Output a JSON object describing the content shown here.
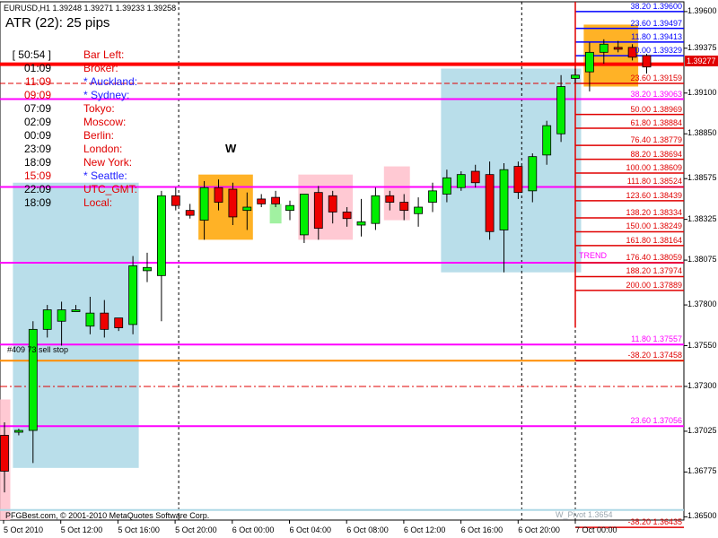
{
  "header": {
    "symbol_line": "EURUSD,H1  1.39248 1.39271 1.39233 1.39258",
    "atr_label": "ATR (22): 25 pips"
  },
  "clock_panel": {
    "rows": [
      {
        "time": "[ 50:54 ]",
        "name": "Bar Left:",
        "time_color": "#000000",
        "name_color": "#e00000"
      },
      {
        "time": "01:09",
        "name": "Broker:",
        "time_color": "#000000",
        "name_color": "#e00000"
      },
      {
        "time": "11:09",
        "name": "* Auckland:",
        "time_color": "#e00000",
        "name_color": "#2020ff"
      },
      {
        "time": "09:09",
        "name": "* Sydney:",
        "time_color": "#e00000",
        "name_color": "#2020ff"
      },
      {
        "time": "07:09",
        "name": "Tokyo:",
        "time_color": "#000000",
        "name_color": "#e00000"
      },
      {
        "time": "02:09",
        "name": "Moscow:",
        "time_color": "#000000",
        "name_color": "#e00000"
      },
      {
        "time": "00:09",
        "name": "Berlin:",
        "time_color": "#000000",
        "name_color": "#e00000"
      },
      {
        "time": "23:09",
        "name": "London:",
        "time_color": "#000000",
        "name_color": "#e00000"
      },
      {
        "time": "18:09",
        "name": "New York:",
        "time_color": "#000000",
        "name_color": "#e00000"
      },
      {
        "time": "15:09",
        "name": "* Seattle:",
        "time_color": "#e00000",
        "name_color": "#2020ff"
      },
      {
        "time": "22:09",
        "name": "UTC_GMT:",
        "time_color": "#000000",
        "name_color": "#e00000"
      },
      {
        "time": "18:09",
        "name": "Local:",
        "time_color": "#000000",
        "name_color": "#e00000"
      }
    ]
  },
  "annotations": {
    "marker": "W",
    "order_label": "#409 73 sell stop",
    "trend_label": "TREND",
    "pivot_label": "W_Pivot 1.3654",
    "copyright": "PFGBest.com, © 2001-2010 MetaQuotes Software Corp."
  },
  "current_price": "1.39277",
  "fib_levels": [
    {
      "ratio": "38.20",
      "price": "1.39600",
      "color": "#0000ff"
    },
    {
      "ratio": "23.60",
      "price": "1.39497",
      "color": "#0000ff"
    },
    {
      "ratio": "11.80",
      "price": "1.39413",
      "color": "#0000ff"
    },
    {
      "ratio": "0.00",
      "price": "1.39329",
      "color": "#0000ff"
    },
    {
      "ratio": "23.60",
      "price": "1.39159",
      "color": "#e00000"
    },
    {
      "ratio": "38.20",
      "price": "1.39063",
      "color": "#ff00ff"
    },
    {
      "ratio": "50.00",
      "price": "1.38969",
      "color": "#e00000"
    },
    {
      "ratio": "61.80",
      "price": "1.38884",
      "color": "#e00000"
    },
    {
      "ratio": "76.40",
      "price": "1.38779",
      "color": "#e00000"
    },
    {
      "ratio": "88.20",
      "price": "1.38694",
      "color": "#e00000"
    },
    {
      "ratio": "100.00",
      "price": "1.38609",
      "color": "#e00000"
    },
    {
      "ratio": "111.80",
      "price": "1.38524",
      "color": "#e00000"
    },
    {
      "ratio": "123.60",
      "price": "1.38439",
      "color": "#e00000"
    },
    {
      "ratio": "138.20",
      "price": "1.38334",
      "color": "#e00000"
    },
    {
      "ratio": "150.00",
      "price": "1.38249",
      "color": "#e00000"
    },
    {
      "ratio": "161.80",
      "price": "1.38164",
      "color": "#e00000"
    },
    {
      "ratio": "176.40",
      "price": "1.38059",
      "color": "#e00000"
    },
    {
      "ratio": "188.20",
      "price": "1.37974",
      "color": "#e00000"
    },
    {
      "ratio": "200.00",
      "price": "1.37889",
      "color": "#e00000"
    },
    {
      "ratio": "11.80",
      "price": "1.37557",
      "color": "#ff00ff"
    },
    {
      "ratio": "-38.20",
      "price": "1.37458",
      "color": "#e00000"
    },
    {
      "ratio": "23.60",
      "price": "1.37056",
      "color": "#ff00ff"
    },
    {
      "ratio": "-38.20",
      "price": "1.36435",
      "color": "#e00000"
    }
  ],
  "chart_data": {
    "type": "candlestick",
    "symbol": "EURUSD",
    "timeframe": "H1",
    "y_range": [
      1.3648,
      1.3966
    ],
    "price_ticks": [
      "1.39600",
      "1.39375",
      "1.39100",
      "1.38850",
      "1.38575",
      "1.38325",
      "1.38075",
      "1.37800",
      "1.37550",
      "1.37300",
      "1.37025",
      "1.36775",
      "1.36500"
    ],
    "time_ticks": [
      "5 Oct 2010",
      "5 Oct 12:00",
      "5 Oct 16:00",
      "5 Oct 20:00",
      "6 Oct 00:00",
      "6 Oct 04:00",
      "6 Oct 08:00",
      "6 Oct 12:00",
      "6 Oct 16:00",
      "6 Oct 20:00",
      "7 Oct 00:00"
    ],
    "candles": [
      {
        "o": 1.37,
        "h": 1.3708,
        "l": 1.3665,
        "c": 1.3678
      },
      {
        "o": 1.3702,
        "h": 1.3704,
        "l": 1.37,
        "c": 1.3703
      },
      {
        "o": 1.3703,
        "h": 1.377,
        "l": 1.3683,
        "c": 1.3765
      },
      {
        "o": 1.3765,
        "h": 1.378,
        "l": 1.376,
        "c": 1.3777
      },
      {
        "o": 1.377,
        "h": 1.3782,
        "l": 1.3755,
        "c": 1.3777
      },
      {
        "o": 1.3777,
        "h": 1.378,
        "l": 1.3776,
        "c": 1.3777
      },
      {
        "o": 1.3767,
        "h": 1.3785,
        "l": 1.3762,
        "c": 1.3775
      },
      {
        "o": 1.3775,
        "h": 1.3783,
        "l": 1.376,
        "c": 1.3765
      },
      {
        "o": 1.3772,
        "h": 1.3772,
        "l": 1.3764,
        "c": 1.3766
      },
      {
        "o": 1.3768,
        "h": 1.381,
        "l": 1.3762,
        "c": 1.3804
      },
      {
        "o": 1.3801,
        "h": 1.3812,
        "l": 1.3794,
        "c": 1.3803
      },
      {
        "o": 1.3798,
        "h": 1.385,
        "l": 1.377,
        "c": 1.3847
      },
      {
        "o": 1.3847,
        "h": 1.3852,
        "l": 1.3838,
        "c": 1.3841
      },
      {
        "o": 1.3838,
        "h": 1.3842,
        "l": 1.3833,
        "c": 1.3835
      },
      {
        "o": 1.3832,
        "h": 1.3856,
        "l": 1.382,
        "c": 1.3852
      },
      {
        "o": 1.3852,
        "h": 1.3857,
        "l": 1.3838,
        "c": 1.3843
      },
      {
        "o": 1.3851,
        "h": 1.3855,
        "l": 1.3829,
        "c": 1.3834
      },
      {
        "o": 1.3838,
        "h": 1.3849,
        "l": 1.3826,
        "c": 1.384
      },
      {
        "o": 1.3845,
        "h": 1.3848,
        "l": 1.384,
        "c": 1.3842
      },
      {
        "o": 1.3846,
        "h": 1.385,
        "l": 1.384,
        "c": 1.3842
      },
      {
        "o": 1.3838,
        "h": 1.3844,
        "l": 1.3832,
        "c": 1.3841
      },
      {
        "o": 1.3823,
        "h": 1.384,
        "l": 1.3818,
        "c": 1.3848
      },
      {
        "o": 1.3849,
        "h": 1.3853,
        "l": 1.382,
        "c": 1.3827
      },
      {
        "o": 1.3847,
        "h": 1.385,
        "l": 1.383,
        "c": 1.3837
      },
      {
        "o": 1.3837,
        "h": 1.384,
        "l": 1.3828,
        "c": 1.3833
      },
      {
        "o": 1.3829,
        "h": 1.3845,
        "l": 1.3822,
        "c": 1.3831
      },
      {
        "o": 1.383,
        "h": 1.3852,
        "l": 1.3826,
        "c": 1.3847
      },
      {
        "o": 1.3847,
        "h": 1.385,
        "l": 1.3838,
        "c": 1.3843
      },
      {
        "o": 1.3843,
        "h": 1.3848,
        "l": 1.3832,
        "c": 1.3838
      },
      {
        "o": 1.3836,
        "h": 1.3846,
        "l": 1.3828,
        "c": 1.384
      },
      {
        "o": 1.3843,
        "h": 1.3855,
        "l": 1.3837,
        "c": 1.385
      },
      {
        "o": 1.3848,
        "h": 1.3863,
        "l": 1.3843,
        "c": 1.3858
      },
      {
        "o": 1.3852,
        "h": 1.3862,
        "l": 1.385,
        "c": 1.386
      },
      {
        "o": 1.3862,
        "h": 1.3866,
        "l": 1.3852,
        "c": 1.3855
      },
      {
        "o": 1.386,
        "h": 1.3868,
        "l": 1.382,
        "c": 1.3825
      },
      {
        "o": 1.3826,
        "h": 1.3867,
        "l": 1.38,
        "c": 1.3863
      },
      {
        "o": 1.3865,
        "h": 1.3868,
        "l": 1.3845,
        "c": 1.3849
      },
      {
        "o": 1.385,
        "h": 1.3873,
        "l": 1.3843,
        "c": 1.3871
      },
      {
        "o": 1.3872,
        "h": 1.3893,
        "l": 1.3866,
        "c": 1.389
      },
      {
        "o": 1.3885,
        "h": 1.3921,
        "l": 1.388,
        "c": 1.3914
      },
      {
        "o": 1.3919,
        "h": 1.3925,
        "l": 1.3916,
        "c": 1.3921
      },
      {
        "o": 1.3923,
        "h": 1.3941,
        "l": 1.3911,
        "c": 1.3935
      },
      {
        "o": 1.3935,
        "h": 1.3943,
        "l": 1.3928,
        "c": 1.394
      },
      {
        "o": 1.3938,
        "h": 1.3942,
        "l": 1.3935,
        "c": 1.3937
      },
      {
        "o": 1.3938,
        "h": 1.394,
        "l": 1.393,
        "c": 1.3932
      },
      {
        "o": 1.3933,
        "h": 1.3934,
        "l": 1.3922,
        "c": 1.3926
      }
    ],
    "horizontal_lines": [
      {
        "price": 1.39277,
        "color": "#ff0000",
        "style": "solid-thick"
      },
      {
        "price": 1.39159,
        "color": "#e00000",
        "style": "dashed"
      },
      {
        "price": 1.39063,
        "color": "#ff00ff",
        "style": "solid"
      },
      {
        "price": 1.38524,
        "color": "#ff00ff",
        "style": "solid"
      },
      {
        "price": 1.38059,
        "color": "#ff00ff",
        "style": "solid"
      },
      {
        "price": 1.37557,
        "color": "#ff00ff",
        "style": "solid"
      },
      {
        "price": 1.37458,
        "color": "#ff8c00",
        "style": "solid"
      },
      {
        "price": 1.37056,
        "color": "#ff00ff",
        "style": "solid"
      },
      {
        "price": 1.373,
        "color": "#e00000",
        "style": "dashdot"
      },
      {
        "price": 1.36542,
        "color": "#add8e6",
        "style": "solid"
      }
    ],
    "session_boxes": [
      {
        "from": 1,
        "to": 9,
        "high": 1.3855,
        "low": 1.368,
        "color": "#add8e6"
      },
      {
        "from": 0,
        "to": 0,
        "high": 1.3722,
        "low": 1.3648,
        "color": "#ffc0cb"
      },
      {
        "from": 14,
        "to": 17,
        "high": 1.386,
        "low": 1.382,
        "color": "#ffa500"
      },
      {
        "from": 19,
        "to": 19,
        "high": 1.3842,
        "low": 1.383,
        "color": "#90ee90"
      },
      {
        "from": 21,
        "to": 24,
        "high": 1.386,
        "low": 1.382,
        "color": "#ffc0cb"
      },
      {
        "from": 27,
        "to": 28,
        "high": 1.3865,
        "low": 1.3832,
        "color": "#ffc0cb"
      },
      {
        "from": 31,
        "to": 40,
        "high": 1.3925,
        "low": 1.38,
        "color": "#add8e6"
      },
      {
        "from": 41,
        "to": 44,
        "high": 1.3952,
        "low": 1.3914,
        "color": "#ffa500"
      }
    ],
    "vertical_dashed_at_ticks": [
      "5 Oct 20:00",
      "6 Oct 20:00"
    ]
  }
}
